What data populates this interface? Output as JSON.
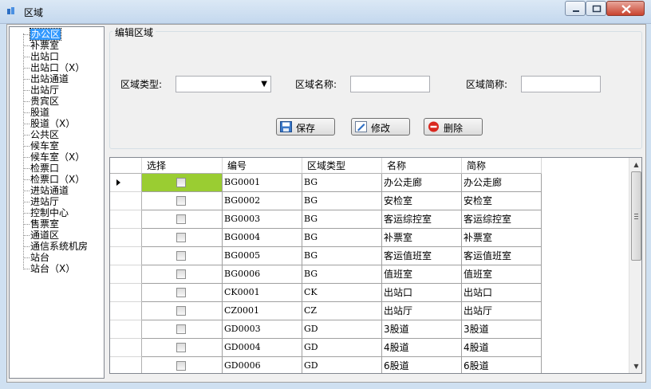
{
  "window": {
    "title": "区域"
  },
  "tree": {
    "items": [
      "办公区",
      "补票室",
      "出站口",
      "出站口（X）",
      "出站通道",
      "出站厅",
      "贵宾区",
      "股道",
      "股道（X）",
      "公共区",
      "候车室",
      "候车室（X）",
      "检票口",
      "检票口（X）",
      "进站通道",
      "进站厅",
      "控制中心",
      "售票室",
      "通道区",
      "通信系统机房",
      "站台",
      "站台（X）"
    ],
    "selected_index": 0
  },
  "editor": {
    "group_title": "编辑区域",
    "type_label": "区域类型:",
    "type_value": "",
    "name_label": "区域名称:",
    "name_value": "",
    "abbr_label": "区域简称:",
    "abbr_value": "",
    "save_label": "保存",
    "edit_label": "修改",
    "delete_label": "删除"
  },
  "grid": {
    "columns": [
      "选择",
      "编号",
      "区域类型",
      "名称",
      "简称"
    ],
    "rows": [
      {
        "code": "BG0001",
        "type": "BG",
        "name": "办公走廊",
        "abbr": "办公走廊",
        "checked": false
      },
      {
        "code": "BG0002",
        "type": "BG",
        "name": "安检室",
        "abbr": "安检室",
        "checked": false
      },
      {
        "code": "BG0003",
        "type": "BG",
        "name": "客运综控室",
        "abbr": "客运综控室",
        "checked": false
      },
      {
        "code": "BG0004",
        "type": "BG",
        "name": "补票室",
        "abbr": "补票室",
        "checked": false
      },
      {
        "code": "BG0005",
        "type": "BG",
        "name": "客运值班室",
        "abbr": "客运值班室",
        "checked": false
      },
      {
        "code": "BG0006",
        "type": "BG",
        "name": "值班室",
        "abbr": "值班室",
        "checked": false
      },
      {
        "code": "CK0001",
        "type": "CK",
        "name": "出站口",
        "abbr": "出站口",
        "checked": false
      },
      {
        "code": "CZ0001",
        "type": "CZ",
        "name": "出站厅",
        "abbr": "出站厅",
        "checked": false
      },
      {
        "code": "GD0003",
        "type": "GD",
        "name": "3股道",
        "abbr": "3股道",
        "checked": false
      },
      {
        "code": "GD0004",
        "type": "GD",
        "name": "4股道",
        "abbr": "4股道",
        "checked": false
      },
      {
        "code": "GD0006",
        "type": "GD",
        "name": "6股道",
        "abbr": "6股道",
        "checked": false
      }
    ]
  },
  "colors": {
    "selection": "#3399ff",
    "current_cell": "#9acd32"
  }
}
